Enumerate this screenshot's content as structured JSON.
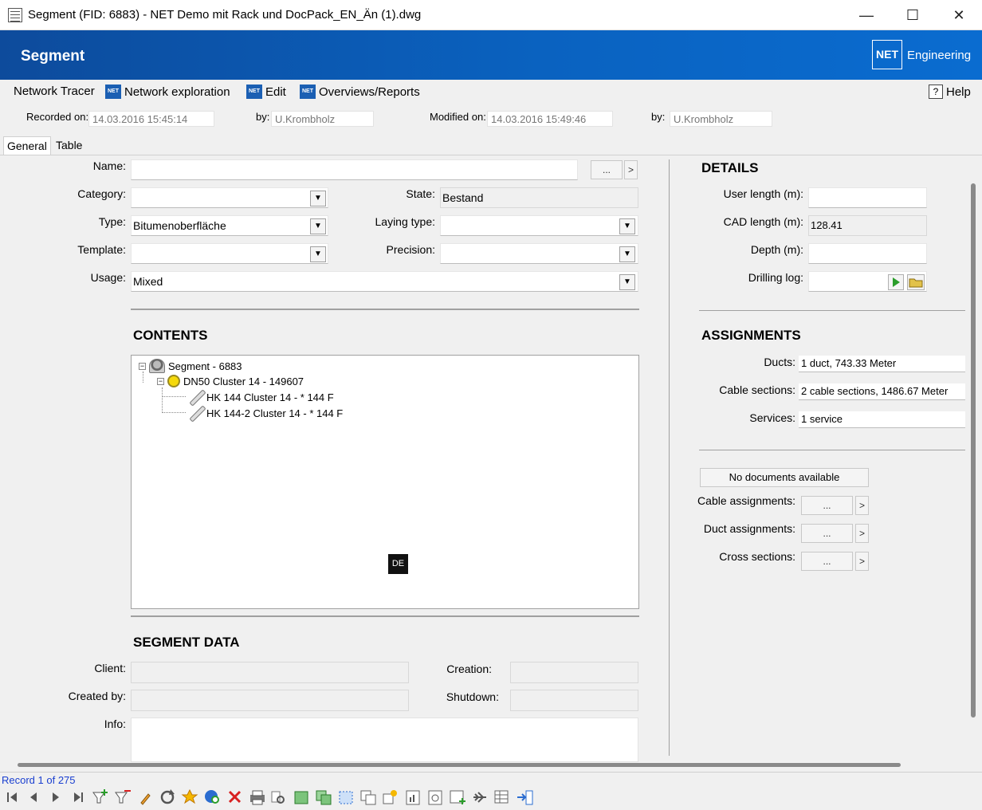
{
  "window": {
    "title": "Segment (FID: 6883) - NET Demo mit Rack und DocPack_EN_Än (1).dwg",
    "minimize": "—",
    "maximize": "☐",
    "close": "✕"
  },
  "banner": {
    "heading": "Segment",
    "logo_mark": "NET",
    "logo_text": "Engineering"
  },
  "menu": {
    "items": [
      "Network Tracer",
      "Network exploration",
      "Edit",
      "Overviews/Reports"
    ],
    "icon_label": "NET",
    "help": "Help",
    "help_glyph": "?"
  },
  "meta": {
    "recorded_on_label": "Recorded on:",
    "recorded_on": "14.03.2016 15:45:14",
    "recorded_by_label": "by:",
    "recorded_by": "U.Krombholz",
    "modified_on_label": "Modified on:",
    "modified_on": "14.03.2016 15:49:46",
    "modified_by_label": "by:",
    "modified_by": "U.Krombholz"
  },
  "tabs": [
    "General",
    "Table"
  ],
  "form": {
    "name_label": "Name:",
    "name_value": "",
    "ellipsis": "...",
    "arrow": ">",
    "dropdown_glyph": "▼",
    "category_label": "Category:",
    "category_value": "",
    "state_label": "State:",
    "state_value": "Bestand",
    "type_label": "Type:",
    "type_value": "Bitumenoberfläche",
    "laying_type_label": "Laying type:",
    "laying_type_value": "",
    "template_label": "Template:",
    "template_value": "",
    "precision_label": "Precision:",
    "precision_value": "",
    "usage_label": "Usage:",
    "usage_value": "Mixed"
  },
  "contents": {
    "title": "CONTENTS",
    "tree": [
      {
        "label": "Segment - 6883",
        "expander": "−"
      },
      {
        "label": "DN50 Cluster 14 - 149607",
        "expander": "−"
      },
      {
        "label": "HK 144 Cluster 14 - * 144 F"
      },
      {
        "label": "HK 144-2 Cluster 14 - * 144 F"
      }
    ],
    "lang_badge": "DE"
  },
  "segment_data": {
    "title": "SEGMENT DATA",
    "client_label": "Client:",
    "created_by_label": "Created by:",
    "creation_label": "Creation:",
    "shutdown_label": "Shutdown:",
    "info_label": "Info:"
  },
  "details": {
    "title": "DETAILS",
    "user_length_label": "User length (m):",
    "user_length_value": "",
    "cad_length_label": "CAD length (m):",
    "cad_length_value": "128.41",
    "depth_label": "Depth (m):",
    "depth_value": "",
    "drilling_log_label": "Drilling log:",
    "drilling_log_value": ""
  },
  "assignments": {
    "title": "ASSIGNMENTS",
    "ducts_label": "Ducts:",
    "ducts_value": "1 duct, 743.33 Meter",
    "cable_sections_label": "Cable sections:",
    "cable_sections_value": "2 cable sections, 1486.67 Meter",
    "services_label": "Services:",
    "services_value": "1 service",
    "no_documents": "No documents available",
    "cable_assignments_label": "Cable assignments:",
    "duct_assignments_label": "Duct assignments:",
    "cross_sections_label": "Cross sections:"
  },
  "status": {
    "record": "Record 1 of 275"
  },
  "colors": {
    "banner_start": "#0d4b9c",
    "banner_end": "#0a6cd0",
    "record_text": "#1a3fd0",
    "play_green": "#2a9d2a"
  },
  "toolbar_icons": [
    "first-record-icon",
    "previous-record-icon",
    "next-record-icon",
    "last-record-icon",
    "add-filter-icon",
    "remove-filter-icon",
    "edit-pencil-icon",
    "refresh-icon",
    "highlight-icon",
    "globe-zoom-icon",
    "delete-icon",
    "print-icon",
    "preview-icon",
    "green-box-icon",
    "copy-box-icon",
    "select-box-icon",
    "duplicate-icon",
    "new-star-icon",
    "report-icon",
    "document-icon",
    "add-report-icon",
    "connections-icon",
    "table-edit-icon",
    "exit-icon"
  ]
}
